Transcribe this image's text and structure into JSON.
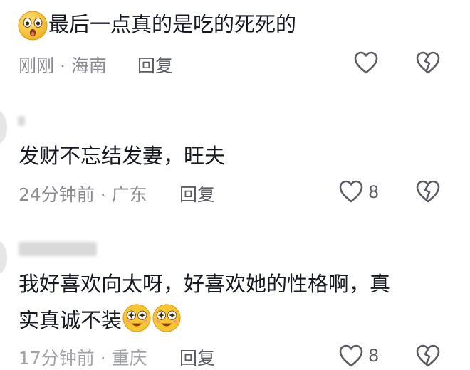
{
  "comments": [
    {
      "text": "最后一点真的是吃的死死的",
      "time": "刚刚",
      "location": "海南",
      "reply_label": "回复",
      "lead_emoji": "astonished-face-emoji",
      "like_icon": "heart-outline-icon",
      "dislike_icon": "broken-heart-icon"
    },
    {
      "text": "发财不忘结发妻，旺夫",
      "time": "24分钟前",
      "location": "广东",
      "reply_label": "回复",
      "like_count": "8",
      "like_icon": "heart-outline-icon",
      "dislike_icon": "broken-heart-icon"
    },
    {
      "text_line1": "我好喜欢向太呀，好喜欢她的性格啊，真",
      "text_line2": "实真诚不装",
      "trail_emoji": "star-struck-face-emoji",
      "time": "17分钟前",
      "location": "重庆",
      "reply_label": "回复",
      "like_count": "8",
      "like_icon": "heart-outline-icon",
      "dislike_icon": "broken-heart-icon"
    }
  ],
  "colors": {
    "text": "#161823",
    "meta": "#8a8b91",
    "icon": "#5a5b63",
    "emoji_yellow": "#f7c52e"
  }
}
